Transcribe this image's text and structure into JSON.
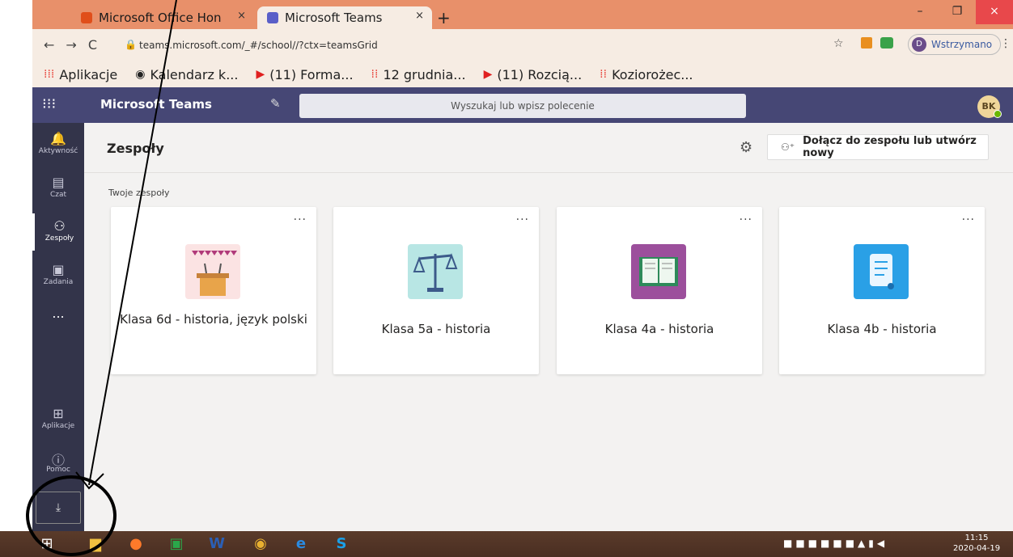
{
  "browser": {
    "tabs": [
      {
        "title": "Microsoft Office Hon"
      },
      {
        "title": "Microsoft Teams"
      }
    ],
    "new_tab": "+",
    "close_glyph": "×",
    "win_controls": {
      "min": "–",
      "max": "❐",
      "close": "×"
    },
    "url": "teams.microsoft.com/_#/school//?ctx=teamsGrid",
    "profile_initial": "D",
    "profile_label": "Wstrzymano",
    "bookmarks": [
      {
        "icon": "apps-grid-icon",
        "label": "Aplikacje"
      },
      {
        "icon": "calendar-icon",
        "label": "Kalendarz k..."
      },
      {
        "icon": "youtube-icon",
        "label": "(11) Forma..."
      },
      {
        "icon": "dots-icon",
        "label": "12 grudnia..."
      },
      {
        "icon": "youtube-icon",
        "label": "(11) Rozcią..."
      },
      {
        "icon": "dots-icon",
        "label": "Koziorożec..."
      }
    ]
  },
  "teams": {
    "app_title": "Microsoft Teams",
    "search_placeholder": "Wyszukaj lub wpisz polecenie",
    "avatar_initials": "BK",
    "rail": [
      {
        "label": "Aktywność",
        "icon": "bell-icon"
      },
      {
        "label": "Czat",
        "icon": "chat-icon"
      },
      {
        "label": "Zespoły",
        "icon": "teams-icon"
      },
      {
        "label": "Zadania",
        "icon": "assignments-icon"
      },
      {
        "label": "...",
        "icon": "more-icon"
      },
      {
        "label": "Aplikacje",
        "icon": "apps-icon"
      },
      {
        "label": "Pomoc",
        "icon": "help-icon"
      }
    ],
    "page_title": "Zespoły",
    "join_button": "Dołącz do zespołu lub utwórz nowy",
    "section_label": "Twoje zespoły",
    "teams_list": [
      {
        "name": "Klasa 6d - historia, język polski",
        "color": "#fbe3e3"
      },
      {
        "name": "Klasa 5a - historia",
        "color": "#b8e6e4"
      },
      {
        "name": "Klasa 4a - historia",
        "color": "#9c4f9c"
      },
      {
        "name": "Klasa 4b - historia",
        "color": "#2aa0e6"
      }
    ]
  },
  "taskbar": {
    "time": "11:15",
    "date": "2020-04-19"
  }
}
